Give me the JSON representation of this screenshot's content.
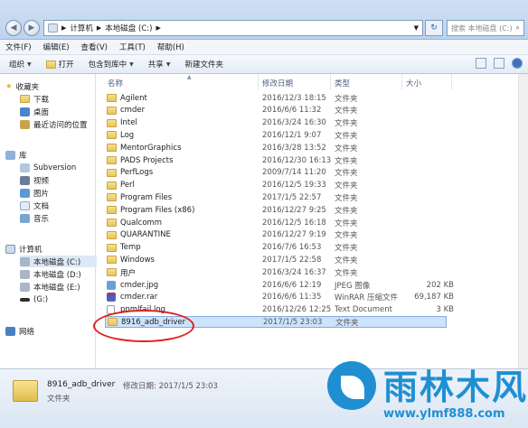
{
  "address": {
    "root": "计算机",
    "path": "本地磁盘 (C:)"
  },
  "search": {
    "placeholder": "搜索 本地磁盘 (C:)"
  },
  "menu": [
    "文件(F)",
    "编辑(E)",
    "查看(V)",
    "工具(T)",
    "帮助(H)"
  ],
  "toolbar": {
    "organize": "组织",
    "open": "打开",
    "include": "包含到库中",
    "share": "共享",
    "new_folder": "新建文件夹"
  },
  "sidebar": {
    "favorites": "收藏夹",
    "fav_items": [
      "下载",
      "桌面",
      "最近访问的位置"
    ],
    "libraries": "库",
    "lib_items": [
      "Subversion",
      "视频",
      "图片",
      "文档",
      "音乐"
    ],
    "computer": "计算机",
    "drives": [
      "本地磁盘 (C:)",
      "本地磁盘 (D:)",
      "本地磁盘 (E:)",
      "(G:)"
    ],
    "network": "网络"
  },
  "columns": {
    "name": "名称",
    "date": "修改日期",
    "type": "类型",
    "size": "大小"
  },
  "files": [
    {
      "name": "Agilent",
      "date": "2016/12/3 18:15",
      "type": "文件夹",
      "size": "",
      "kind": "folder"
    },
    {
      "name": "cmder",
      "date": "2016/6/6 11:32",
      "type": "文件夹",
      "size": "",
      "kind": "folder"
    },
    {
      "name": "Intel",
      "date": "2016/3/24 16:30",
      "type": "文件夹",
      "size": "",
      "kind": "folder"
    },
    {
      "name": "Log",
      "date": "2016/12/1 9:07",
      "type": "文件夹",
      "size": "",
      "kind": "folder"
    },
    {
      "name": "MentorGraphics",
      "date": "2016/3/28 13:52",
      "type": "文件夹",
      "size": "",
      "kind": "folder"
    },
    {
      "name": "PADS Projects",
      "date": "2016/12/30 16:13",
      "type": "文件夹",
      "size": "",
      "kind": "folder"
    },
    {
      "name": "PerfLogs",
      "date": "2009/7/14 11:20",
      "type": "文件夹",
      "size": "",
      "kind": "folder"
    },
    {
      "name": "Perl",
      "date": "2016/12/5 19:33",
      "type": "文件夹",
      "size": "",
      "kind": "folder"
    },
    {
      "name": "Program Files",
      "date": "2017/1/5 22:57",
      "type": "文件夹",
      "size": "",
      "kind": "folder"
    },
    {
      "name": "Program Files (x86)",
      "date": "2016/12/27 9:25",
      "type": "文件夹",
      "size": "",
      "kind": "folder"
    },
    {
      "name": "Qualcomm",
      "date": "2016/12/5 16:18",
      "type": "文件夹",
      "size": "",
      "kind": "folder"
    },
    {
      "name": "QUARANTINE",
      "date": "2016/12/27 9:19",
      "type": "文件夹",
      "size": "",
      "kind": "folder"
    },
    {
      "name": "Temp",
      "date": "2016/7/6 16:53",
      "type": "文件夹",
      "size": "",
      "kind": "folder"
    },
    {
      "name": "Windows",
      "date": "2017/1/5 22:58",
      "type": "文件夹",
      "size": "",
      "kind": "folder"
    },
    {
      "name": "用户",
      "date": "2016/3/24 16:37",
      "type": "文件夹",
      "size": "",
      "kind": "folder"
    },
    {
      "name": "cmder.jpg",
      "date": "2016/6/6 12:19",
      "type": "JPEG 图像",
      "size": "202 KB",
      "kind": "image"
    },
    {
      "name": "cmder.rar",
      "date": "2016/6/6 11:35",
      "type": "WinRAR 压缩文件",
      "size": "69,187 KB",
      "kind": "rar"
    },
    {
      "name": "pnmlfail.log",
      "date": "2016/12/26 12:25",
      "type": "Text Document",
      "size": "3 KB",
      "kind": "text"
    },
    {
      "name": "8916_adb_driver",
      "date": "2017/1/5 23:03",
      "type": "文件夹",
      "size": "",
      "kind": "folder"
    }
  ],
  "details": {
    "name": "8916_adb_driver",
    "date_label": "修改日期: 2017/1/5 23:03",
    "type": "文件夹"
  },
  "watermark": {
    "title": "雨林木风",
    "url": "www.ylmf888.com"
  },
  "colors": {
    "accent": "#1f8fd2",
    "annotation": "#e0201c",
    "selection": "#cde3fa"
  }
}
